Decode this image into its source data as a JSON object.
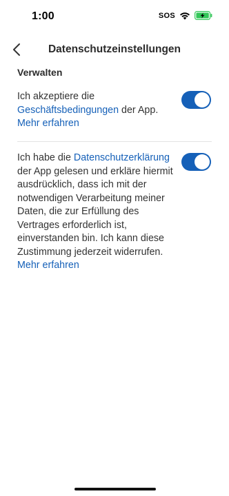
{
  "status_bar": {
    "time": "1:00",
    "sos": "SOS",
    "wifi_icon": "wifi-icon",
    "battery_icon": "battery-charging-icon",
    "battery_color": "#34c759"
  },
  "nav": {
    "back_icon": "chevron-left-icon",
    "title": "Datenschutzeinstellungen"
  },
  "section": {
    "heading": "Verwalten"
  },
  "consents": [
    {
      "text_before": "Ich akzeptiere die ",
      "link_text": "Geschäftsbedingungen",
      "text_after": " der App.",
      "more_label": "Mehr erfahren",
      "enabled": true
    },
    {
      "text_before": "Ich habe die ",
      "link_text": "Datenschutzerklärung",
      "text_after": " der App gelesen und erkläre hiermit ausdrücklich, dass ich mit der notwendigen Verarbeitung meiner Daten, die zur Erfüllung des Vertrages erforderlich ist, einverstanden bin. Ich kann diese Zustimmung jederzeit widerrufen.",
      "more_label": "Mehr erfahren",
      "enabled": true
    }
  ],
  "colors": {
    "accent": "#1560b8",
    "toggle_on": "#1560b8",
    "toggle_off": "#c7c7cc",
    "text": "#333333"
  }
}
